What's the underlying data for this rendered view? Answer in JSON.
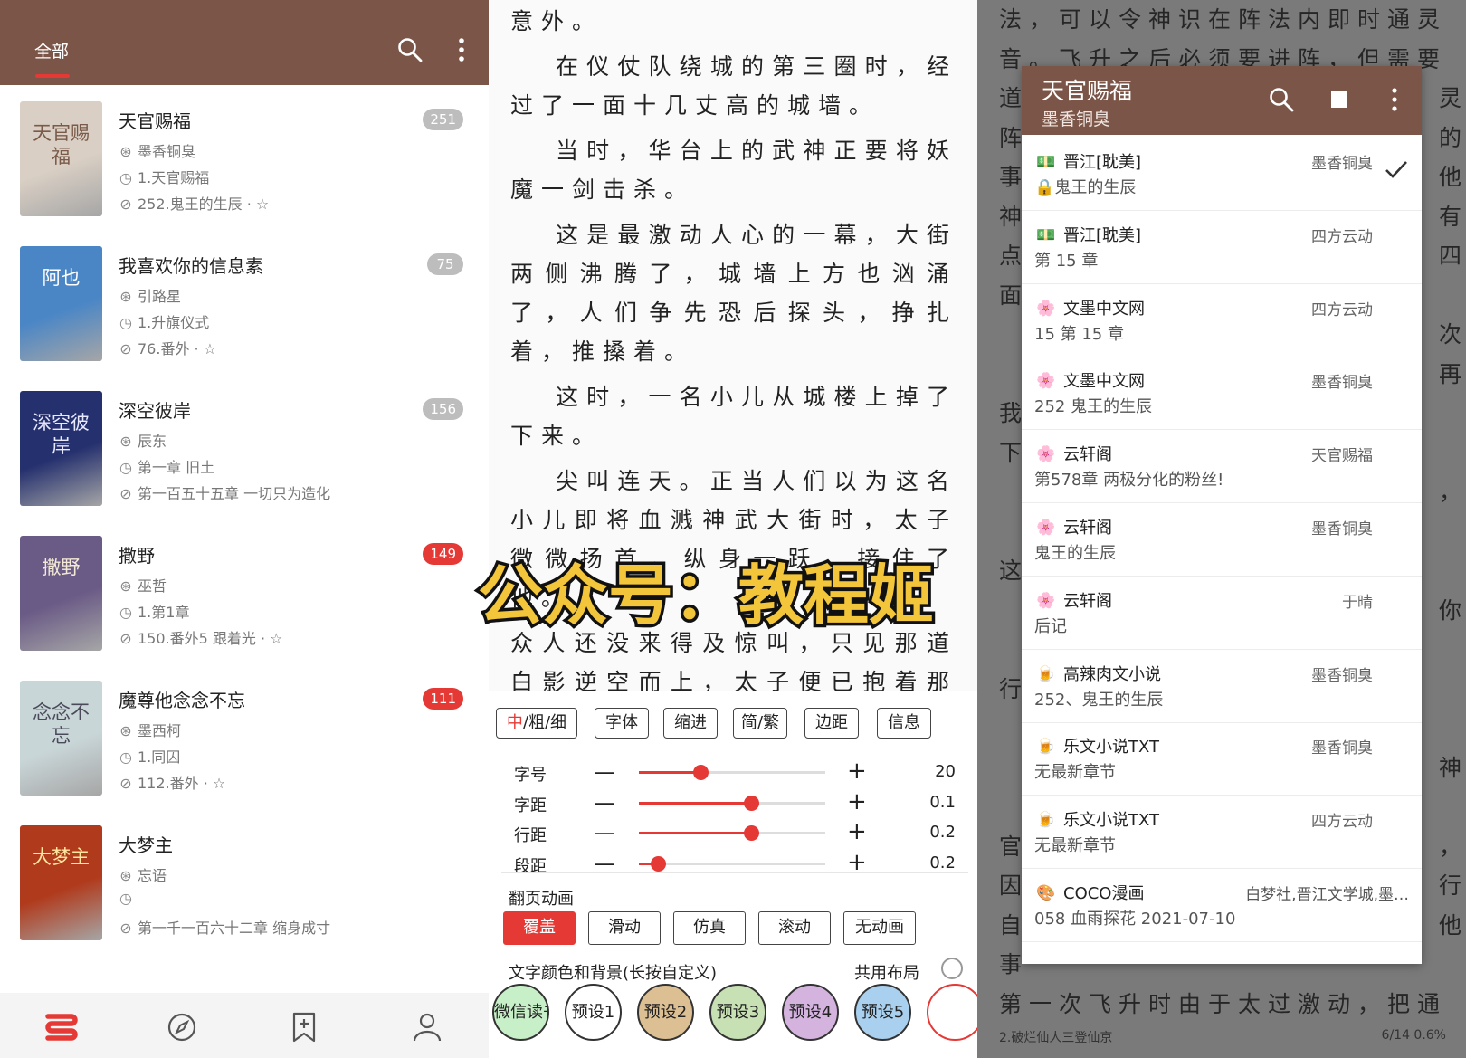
{
  "bookshelf": {
    "tab_label": "全部",
    "books": [
      {
        "title": "天官赐福",
        "count": "251",
        "count_style": "grey",
        "author": "墨香铜臭",
        "first_chapter": "1.天官赐福",
        "latest_chapter": "252.鬼王的生辰 · ☆",
        "cover_text": "天官赐福",
        "cover_bg": "#d9cfc4",
        "cover_fg": "#7a5a48"
      },
      {
        "title": "我喜欢你的信息素",
        "count": "75",
        "count_style": "grey",
        "author": "引路星",
        "first_chapter": "1.升旗仪式",
        "latest_chapter": "76.番外 · ☆",
        "cover_text": "阿也",
        "cover_bg": "#4a86c6",
        "cover_fg": "#ffffff"
      },
      {
        "title": "深空彼岸",
        "count": "156",
        "count_style": "grey",
        "author": "辰东",
        "first_chapter": "第一章 旧土",
        "latest_chapter": "第一百五十五章 一切只为造化",
        "cover_text": "深空彼岸",
        "cover_bg": "#25306e",
        "cover_fg": "#e8e8ff"
      },
      {
        "title": "撒野",
        "count": "149",
        "count_style": "red",
        "author": "巫哲",
        "first_chapter": "1.第1章",
        "latest_chapter": "150.番外5 跟着光 · ☆",
        "cover_text": "撒野",
        "cover_bg": "#6a5a86",
        "cover_fg": "#f3e9d4"
      },
      {
        "title": "魔尊他念念不忘",
        "count": "111",
        "count_style": "red",
        "author": "墨西柯",
        "first_chapter": "1.同囚",
        "latest_chapter": "112.番外 · ☆",
        "cover_text": "念念不忘",
        "cover_bg": "#c9d6d8",
        "cover_fg": "#4a4a5a"
      },
      {
        "title": "大梦主",
        "count": "",
        "count_style": "grey",
        "author": "忘语",
        "first_chapter": "",
        "latest_chapter": "第一千一百六十二章 缩身成寸",
        "cover_text": "大梦主",
        "cover_bg": "#b03a1c",
        "cover_fg": "#ffe7a0"
      }
    ],
    "icons": {
      "search": "search-icon",
      "more": "more-vert-icon",
      "clock": "clock-icon",
      "compass": "compass-icon",
      "person": "person-icon"
    }
  },
  "reader": {
    "paragraphs": [
      {
        "text": "可是，那一天，却发生了一件意外。",
        "cont": false
      },
      {
        "text": "在仪仗队绕城的第三圈时，经过了一面十几丈高的城墙。",
        "cont": false
      },
      {
        "text": "当时，华台上的武神正要将妖魔一剑击杀。",
        "cont": false
      },
      {
        "text": "这是最激动人心的一幕，大街两侧沸腾了，城墙上方也汹涌了，人们争先恐后探头，挣扎着，推搡着。",
        "cont": false
      },
      {
        "text": "这时，一名小儿从城楼上掉了下来。",
        "cont": false
      },
      {
        "text": "尖叫连天。正当人们以为这名小儿即将血溅神武大街时，太子微微扬首，纵身一跃，接住了他。",
        "cont": false
      },
      {
        "text": "众人还没来得及惊叫，只见那道白影逆空而上，太子便已抱着那名小儿安然落地，黄金面具坠落，露出了",
        "cont": true
      }
    ],
    "format_buttons": [
      {
        "label_red": "中",
        "label": "/粗/细"
      },
      {
        "label_red": "",
        "label": "字体"
      },
      {
        "label_red": "",
        "label": "缩进"
      },
      {
        "label_red": "",
        "label": "简/繁"
      },
      {
        "label_red": "",
        "label": "边距"
      },
      {
        "label_red": "",
        "label": "信息"
      }
    ],
    "sliders": [
      {
        "label": "字号",
        "value": "20",
        "level": 0.33
      },
      {
        "label": "字距",
        "value": "0.1",
        "level": 0.6
      },
      {
        "label": "行距",
        "value": "0.2",
        "level": 0.6
      },
      {
        "label": "段距",
        "value": "0.2",
        "level": 0.1
      }
    ],
    "page_anim_label": "翻页动画",
    "page_anims": [
      "覆盖",
      "滑动",
      "仿真",
      "滚动",
      "无动画"
    ],
    "page_anim_active": "覆盖",
    "color_label": "文字颜色和背景(长按自定义)",
    "share_layout_label": "共用布局",
    "presets": [
      {
        "label": "微信读书",
        "bg": "#c8f0c8"
      },
      {
        "label": "预设1",
        "bg": "#ffffff"
      },
      {
        "label": "预设2",
        "bg": "#dcbf92"
      },
      {
        "label": "预设3",
        "bg": "#c7e1b4"
      },
      {
        "label": "预设4",
        "bg": "#d4b4df"
      },
      {
        "label": "预设5",
        "bg": "#a9d0ee"
      }
    ]
  },
  "source_switch": {
    "book_title": "天官赐福",
    "book_author": "墨香铜臭",
    "sources": [
      {
        "icon": "💵",
        "name": "晋江[耽美]",
        "author": "墨香铜臭",
        "chapter": "🔒鬼王的生辰",
        "checked": true
      },
      {
        "icon": "💵",
        "name": "晋江[耽美]",
        "author": "四方云动",
        "chapter": "第 15 章",
        "checked": false
      },
      {
        "icon": "🌸",
        "name": "文墨中文网",
        "author": "四方云动",
        "chapter": "15 第 15 章",
        "checked": false
      },
      {
        "icon": "🌸",
        "name": "文墨中文网",
        "author": "墨香铜臭",
        "chapter": "252 鬼王的生辰",
        "checked": false
      },
      {
        "icon": "🌸",
        "name": "云轩阁",
        "author": "天官赐福",
        "chapter": "第578章 两极分化的粉丝!",
        "checked": false
      },
      {
        "icon": "🌸",
        "name": "云轩阁",
        "author": "墨香铜臭",
        "chapter": "鬼王的生辰",
        "checked": false
      },
      {
        "icon": "🌸",
        "name": "云轩阁",
        "author": "于晴",
        "chapter": "后记",
        "checked": false
      },
      {
        "icon": "🍺",
        "name": "高辣肉文小说",
        "author": "墨香铜臭",
        "chapter": "252、鬼王的生辰",
        "checked": false
      },
      {
        "icon": "🍺",
        "name": "乐文小说TXT",
        "author": "墨香铜臭",
        "chapter": "无最新章节",
        "checked": false
      },
      {
        "icon": "🍺",
        "name": "乐文小说TXT",
        "author": "四方云动",
        "chapter": "无最新章节",
        "checked": false
      },
      {
        "icon": "🎨",
        "name": "COCO漫画",
        "author": "白梦社,晋江文学城,墨…",
        "chapter": "058 血雨探花 2021-07-10",
        "checked": false
      }
    ],
    "background_lines": [
      "法，可以令神识在阵法内即时通灵传",
      "音。飞升之后必须要进阵，但需要知",
      "道",
      "阵",
      "事",
      "神",
      "点",
      "面",
      "",
      "",
      "我",
      "下",
      "",
      "",
      "这",
      "",
      "",
      "行",
      "",
      "",
      "",
      "官",
      "因",
      "自",
      "事",
      "第一次飞升时由于太过激动，把通灵"
    ],
    "background_right_chars": [
      "",
      "",
      "灵",
      "的",
      "他",
      "有",
      "四",
      "",
      "次",
      "再",
      "",
      "",
      "，",
      "",
      "",
      "你",
      "",
      "",
      "",
      "神",
      "",
      "，",
      "行",
      "他",
      ""
    ],
    "status_left": "2.破烂仙人三登仙京",
    "status_right": "6/14  0.6%"
  },
  "watermark": {
    "text": "公众号：教程姬"
  }
}
